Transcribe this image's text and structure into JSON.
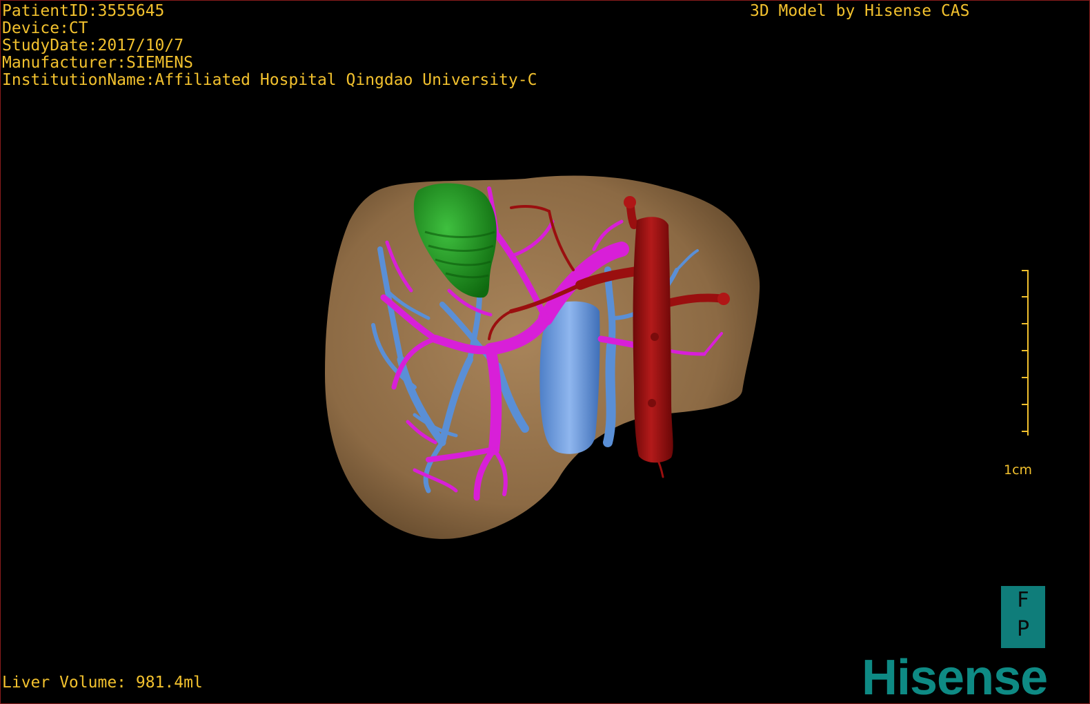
{
  "overlay": {
    "patient_id": "PatientID:3555645",
    "device": "Device:CT",
    "study_date": "StudyDate:2017/10/7",
    "manufacturer": "Manufacturer:SIEMENS",
    "institution": "InstitutionName:Affiliated Hospital Qingdao University-C",
    "credit": "3D Model by Hisense CAS",
    "liver_volume": "Liver Volume: 981.4ml"
  },
  "scale": {
    "label": "1cm"
  },
  "orientation": {
    "top": "F",
    "bottom": "P"
  },
  "brand": {
    "name": "Hisense"
  },
  "colors": {
    "text": "#f2c12e",
    "liver": "#8c6a44",
    "gallbladder": "#1f8f1f",
    "portal_vein": "#d81fd8",
    "hepatic_vein": "#5a8fd6",
    "artery": "#9a0f0f",
    "brand": "#0e8a84"
  }
}
